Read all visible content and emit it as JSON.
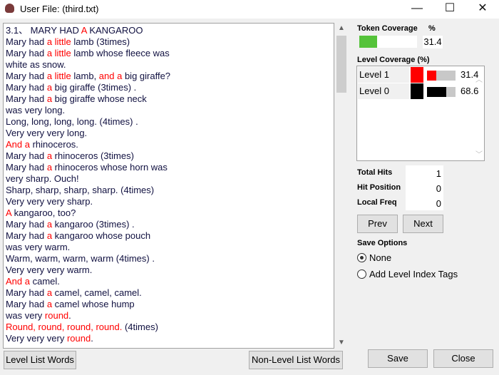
{
  "window": {
    "title": "User File: (third.txt)",
    "minimize": "—",
    "maximize": "☐",
    "close": "✕"
  },
  "text": {
    "lines": [
      [
        {
          "t": "3.1、 MARY HAD "
        },
        {
          "t": "A",
          "r": 1
        },
        {
          "t": " KANGAROO"
        }
      ],
      [
        {
          "t": "Mary had "
        },
        {
          "t": "a little",
          "r": 1
        },
        {
          "t": " lamb (3times)"
        }
      ],
      [
        {
          "t": "Mary had "
        },
        {
          "t": "a little",
          "r": 1
        },
        {
          "t": " lamb whose fleece was"
        }
      ],
      [
        {
          "t": "white as snow."
        }
      ],
      [
        {
          "t": "Mary had "
        },
        {
          "t": "a little",
          "r": 1
        },
        {
          "t": " lamb, "
        },
        {
          "t": "and a",
          "r": 1
        },
        {
          "t": " big giraffe?"
        }
      ],
      [
        {
          "t": "Mary had "
        },
        {
          "t": "a",
          "r": 1
        },
        {
          "t": " big giraffe (3times) ."
        }
      ],
      [
        {
          "t": "Mary had "
        },
        {
          "t": "a",
          "r": 1
        },
        {
          "t": " big giraffe whose neck"
        }
      ],
      [
        {
          "t": "was very long."
        }
      ],
      [
        {
          "t": "Long, long, long, long. (4times) ."
        }
      ],
      [
        {
          "t": "Very very very long."
        }
      ],
      [
        {
          "t": "And a",
          "r": 1
        },
        {
          "t": " rhinoceros."
        }
      ],
      [
        {
          "t": "Mary had "
        },
        {
          "t": "a",
          "r": 1
        },
        {
          "t": " rhinoceros (3times)"
        }
      ],
      [
        {
          "t": "Mary had "
        },
        {
          "t": "a",
          "r": 1
        },
        {
          "t": " rhinoceros whose horn was"
        }
      ],
      [
        {
          "t": "very sharp. Ouch!"
        }
      ],
      [
        {
          "t": "Sharp, sharp, sharp, sharp. (4times)"
        }
      ],
      [
        {
          "t": "Very very very sharp."
        }
      ],
      [
        {
          "t": "A",
          "r": 1
        },
        {
          "t": " kangaroo, too?"
        }
      ],
      [
        {
          "t": "Mary had "
        },
        {
          "t": "a",
          "r": 1
        },
        {
          "t": " kangaroo (3times) ."
        }
      ],
      [
        {
          "t": "Mary had "
        },
        {
          "t": "a",
          "r": 1
        },
        {
          "t": " kangaroo whose pouch"
        }
      ],
      [
        {
          "t": "was very warm."
        }
      ],
      [
        {
          "t": "Warm, warm, warm, warm (4times) ."
        }
      ],
      [
        {
          "t": "Very very very warm."
        }
      ],
      [
        {
          "t": "And a",
          "r": 1
        },
        {
          "t": " camel."
        }
      ],
      [
        {
          "t": "Mary had "
        },
        {
          "t": "a",
          "r": 1
        },
        {
          "t": " camel, camel, camel."
        }
      ],
      [
        {
          "t": "Mary had "
        },
        {
          "t": "a",
          "r": 1
        },
        {
          "t": " camel whose hump"
        }
      ],
      [
        {
          "t": "was very "
        },
        {
          "t": "round",
          "r": 1
        },
        {
          "t": "."
        }
      ],
      [
        {
          "t": "Round, round, round, round.",
          "r": 1
        },
        {
          "t": " (4times)"
        }
      ],
      [
        {
          "t": "Very very very "
        },
        {
          "t": "round",
          "r": 1
        },
        {
          "t": "."
        }
      ]
    ]
  },
  "colors": {
    "highlight": "#ff0000",
    "token_bar": "#55c33a",
    "level1": "#ff0000",
    "level0": "#000000"
  },
  "token_coverage": {
    "label": "Token Coverage",
    "unit": "%",
    "value": "31.4",
    "fill_percent": 31.4
  },
  "level_coverage": {
    "label": "Level Coverage (%)",
    "levels": [
      {
        "name": "Level 1",
        "value": "31.4",
        "fill_percent": 31.4
      },
      {
        "name": "Level 0",
        "value": "68.6",
        "fill_percent": 68.6
      }
    ]
  },
  "stats": {
    "total_hits_label": "Total Hits",
    "total_hits": "1",
    "hit_position_label": "Hit Position",
    "hit_position": "0",
    "local_freq_label": "Local Freq",
    "local_freq": "0"
  },
  "buttons": {
    "prev": "Prev",
    "next": "Next",
    "level_list": "Level List Words",
    "non_level_list": "Non-Level List Words",
    "save": "Save",
    "close": "Close"
  },
  "save_options": {
    "label": "Save Options",
    "options": [
      {
        "label": "None",
        "selected": true
      },
      {
        "label": "Add Level Index Tags",
        "selected": false
      }
    ]
  }
}
